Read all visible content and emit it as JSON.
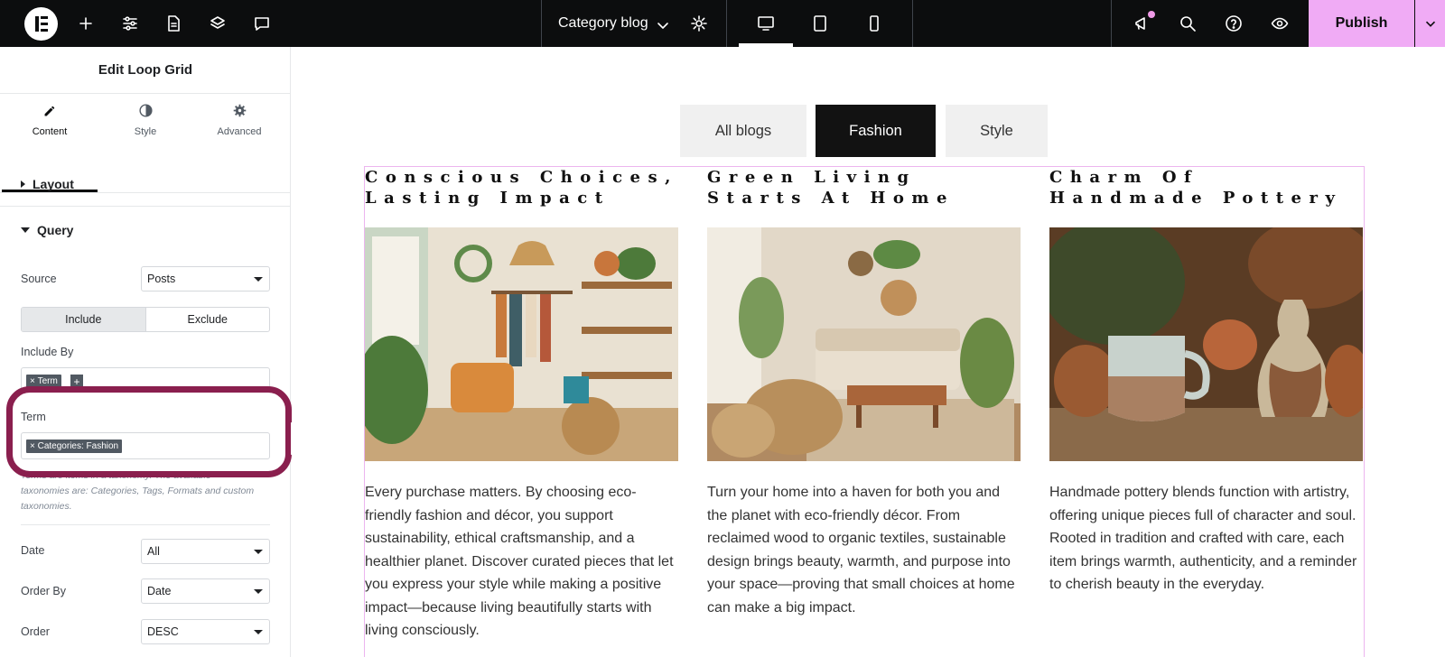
{
  "topbar": {
    "document_title": "Category blog",
    "publish_label": "Publish",
    "icons": [
      "elementor-logo-icon",
      "add-icon",
      "sliders-icon",
      "page-icon",
      "layers-icon",
      "comment-icon",
      "chevron-down-icon",
      "gear-icon",
      "desktop-icon",
      "tablet-icon",
      "mobile-icon",
      "whats-new-icon",
      "search-icon",
      "help-icon",
      "preview-eye-icon"
    ],
    "accent_color": "#f0abf5"
  },
  "panel": {
    "title": "Edit Loop Grid",
    "tabs": [
      {
        "label": "Content",
        "icon": "pencil-icon",
        "active": true
      },
      {
        "label": "Style",
        "icon": "contrast-icon",
        "active": false
      },
      {
        "label": "Advanced",
        "icon": "gear-icon",
        "active": false
      }
    ],
    "sections": {
      "layout": "Layout",
      "query": "Query"
    },
    "fields": {
      "source_label": "Source",
      "source_value": "Posts",
      "include_label": "Include",
      "exclude_label": "Exclude",
      "include_by_label": "Include By",
      "include_by_chip": "Term",
      "term_label": "Term",
      "term_chip": "Categories: Fashion",
      "term_help": "Terms are items in a taxonomy. The available taxonomies are: Categories, Tags, Formats and custom taxonomies.",
      "date_label": "Date",
      "date_value": "All",
      "order_by_label": "Order By",
      "order_by_value": "Date",
      "order_label": "Order",
      "order_value": "DESC"
    },
    "highlight_color": "#8a1f4e"
  },
  "canvas": {
    "filters": [
      {
        "label": "All blogs",
        "active": false
      },
      {
        "label": "Fashion",
        "active": true
      },
      {
        "label": "Style",
        "active": false
      }
    ],
    "cards": [
      {
        "title": "Conscious Choices,\nLasting Impact",
        "image": "boho-fashion-boutique-interior",
        "text": "Every purchase matters. By choosing eco-friendly fashion and décor, you support sustainability, ethical craftsmanship, and a healthier planet. Discover curated pieces that let you express your style while making a positive impact—because living beautifully starts with living consciously."
      },
      {
        "title": "Green Living\nStarts At Home",
        "image": "eco-living-room-with-baskets",
        "text": "Turn your home into a haven for both you and the planet with eco-friendly décor. From reclaimed wood to organic textiles, sustainable design brings beauty, warmth, and purpose into your space—proving that small choices at home can make a big impact."
      },
      {
        "title": "Charm Of\nHandmade Pottery",
        "image": "handmade-ceramic-pottery",
        "text": "Handmade pottery blends function with artistry, offering unique pieces full of character and soul. Rooted in tradition and crafted with care, each item brings warmth, authenticity, and a reminder to cherish beauty in the everyday."
      }
    ]
  }
}
